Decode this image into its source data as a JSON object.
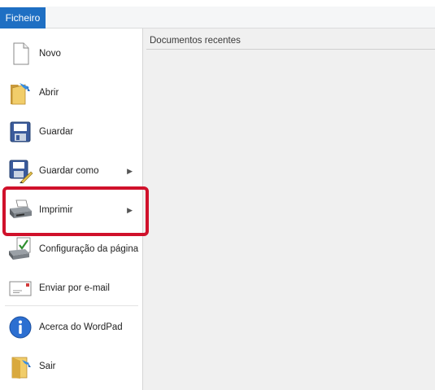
{
  "ribbon": {
    "file_tab_label": "Ficheiro"
  },
  "menu": {
    "items": [
      {
        "label": "Novo",
        "icon": "new-document-icon",
        "has_submenu": false
      },
      {
        "label": "Abrir",
        "icon": "open-folder-icon",
        "has_submenu": false
      },
      {
        "label": "Guardar",
        "icon": "save-disk-icon",
        "has_submenu": false
      },
      {
        "label": "Guardar como",
        "icon": "save-as-icon",
        "has_submenu": true
      },
      {
        "label": "Imprimir",
        "icon": "printer-icon",
        "has_submenu": true
      },
      {
        "label": "Configuração da página",
        "icon": "page-setup-icon",
        "has_submenu": false
      },
      {
        "label": "Enviar por e-mail",
        "icon": "email-icon",
        "has_submenu": false
      },
      {
        "label": "Acerca do WordPad",
        "icon": "info-icon",
        "has_submenu": false
      },
      {
        "label": "Sair",
        "icon": "exit-icon",
        "has_submenu": false
      }
    ],
    "submenu_arrow": "▶"
  },
  "recent": {
    "title": "Documentos recentes"
  },
  "colors": {
    "file_tab": "#1e6fc3",
    "highlight": "#d0112b",
    "recent_bg": "#f0f0f0"
  }
}
